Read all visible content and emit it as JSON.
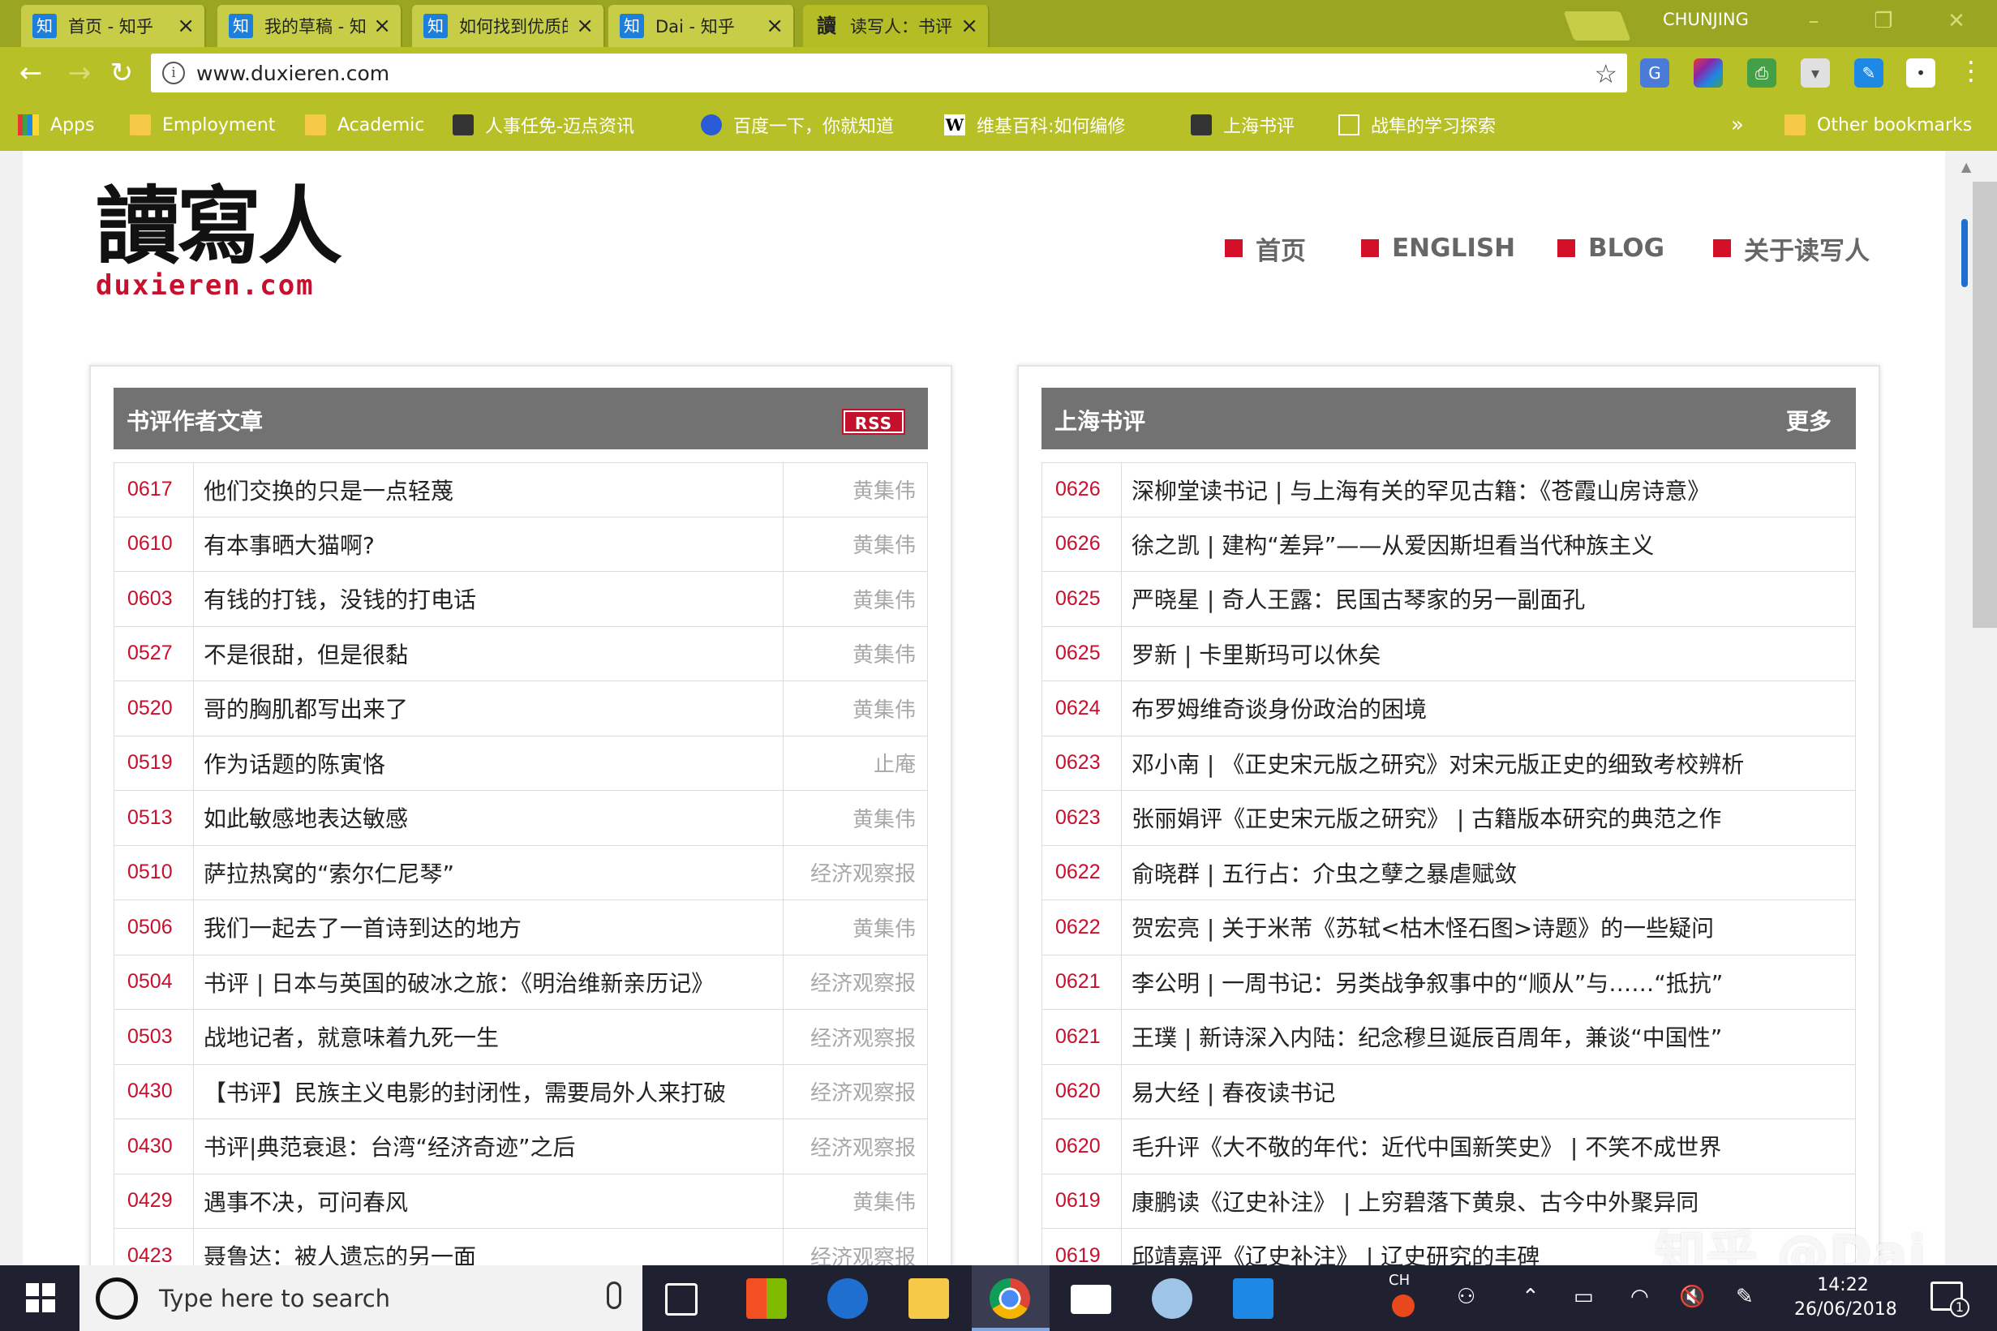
{
  "browser": {
    "tabs": [
      {
        "icon": "知",
        "title": "首页 - 知乎",
        "active": false
      },
      {
        "icon": "知",
        "title": "我的草稿 - 知乎",
        "active": false
      },
      {
        "icon": "知",
        "title": "如何找到优质的书评？有",
        "active": false
      },
      {
        "icon": "知",
        "title": "Dai - 知乎",
        "active": false
      },
      {
        "icon": "讀",
        "title": "读写人：书评杂志、书评",
        "active": true
      }
    ],
    "close_glyph": "×",
    "profile": "CHUNJING",
    "url": "www.duxieren.com",
    "bookmarks": [
      {
        "label": "Apps",
        "icon": "apps-icon"
      },
      {
        "label": "Employment",
        "icon": "folder-icon"
      },
      {
        "label": "Academic",
        "icon": "folder-icon"
      },
      {
        "label": "人事任免-迈点资讯",
        "icon": "mark-icon"
      },
      {
        "label": "百度一下，你就知道",
        "icon": "baidu-icon"
      },
      {
        "label": "维基百科:如何编修",
        "icon": "wiki-icon"
      },
      {
        "label": "上海书评",
        "icon": "mark-icon"
      },
      {
        "label": "战隼的学习探索",
        "icon": "doc-icon"
      }
    ],
    "bookmarks_overflow": "»",
    "other_bookmarks": "Other bookmarks"
  },
  "site": {
    "logo_cn": "讀寫人",
    "logo_en": "duxieren.com",
    "nav": [
      "首页",
      "ENGLISH",
      "BLOG",
      "关于读写人"
    ],
    "accent_color": "#d40f2a"
  },
  "left_panel": {
    "title": "书评作者文章",
    "badge": "RSS",
    "rows": [
      {
        "date": "0617",
        "title": "他们交换的只是一点轻蔑",
        "author": "黄集伟"
      },
      {
        "date": "0610",
        "title": "有本事晒大猫啊?",
        "author": "黄集伟"
      },
      {
        "date": "0603",
        "title": "有钱的打钱，没钱的打电话",
        "author": "黄集伟"
      },
      {
        "date": "0527",
        "title": "不是很甜，但是很黏",
        "author": "黄集伟"
      },
      {
        "date": "0520",
        "title": "哥的胸肌都写出来了",
        "author": "黄集伟"
      },
      {
        "date": "0519",
        "title": "作为话题的陈寅恪",
        "author": "止庵"
      },
      {
        "date": "0513",
        "title": "如此敏感地表达敏感",
        "author": "黄集伟"
      },
      {
        "date": "0510",
        "title": "萨拉热窝的“索尔仁尼琴”",
        "author": "经济观察报"
      },
      {
        "date": "0506",
        "title": "我们一起去了一首诗到达的地方",
        "author": "黄集伟"
      },
      {
        "date": "0504",
        "title": "书评 | 日本与英国的破冰之旅：《明治维新亲历记》",
        "author": "经济观察报"
      },
      {
        "date": "0503",
        "title": "战地记者，就意味着九死一生",
        "author": "经济观察报"
      },
      {
        "date": "0430",
        "title": "【书评】民族主义电影的封闭性，需要局外人来打破",
        "author": "经济观察报"
      },
      {
        "date": "0430",
        "title": "书评|典范衰退：台湾“经济奇迹”之后",
        "author": "经济观察报"
      },
      {
        "date": "0429",
        "title": "遇事不决，可问春风",
        "author": "黄集伟"
      },
      {
        "date": "0423",
        "title": "聂鲁达：被人遗忘的另一面",
        "author": "经济观察报"
      }
    ]
  },
  "right_panel": {
    "title": "上海书评",
    "more": "更多",
    "rows": [
      {
        "date": "0626",
        "title": "深柳堂读书记 | 与上海有关的罕见古籍：《苍霞山房诗意》"
      },
      {
        "date": "0626",
        "title": "徐之凯 | 建构“差异”——从爱因斯坦看当代种族主义"
      },
      {
        "date": "0625",
        "title": "严晓星 | 奇人王露：民国古琴家的另一副面孔"
      },
      {
        "date": "0625",
        "title": "罗新 | 卡里斯玛可以休矣"
      },
      {
        "date": "0624",
        "title": "布罗姆维奇谈身份政治的困境"
      },
      {
        "date": "0623",
        "title": "邓小南 | 《正史宋元版之研究》对宋元版正史的细致考校辨析"
      },
      {
        "date": "0623",
        "title": "张丽娟评《正史宋元版之研究》 | 古籍版本研究的典范之作"
      },
      {
        "date": "0622",
        "title": "俞晓群 | 五行占：介虫之孽之暴虐赋敛"
      },
      {
        "date": "0622",
        "title": "贺宏亮 | 关于米芾《苏轼<枯木怪石图>诗题》的一些疑问"
      },
      {
        "date": "0621",
        "title": "李公明 | 一周书记：另类战争叙事中的“顺从”与……“抵抗”"
      },
      {
        "date": "0621",
        "title": "王璞 | 新诗深入内陆：纪念穆旦诞辰百周年，兼谈“中国性”"
      },
      {
        "date": "0620",
        "title": "易大经 | 春夜读书记"
      },
      {
        "date": "0620",
        "title": "毛升评《大不敬的年代：近代中国新笑史》 | 不笑不成世界"
      },
      {
        "date": "0619",
        "title": "康鹏读《辽史补注》 | 上穷碧落下黄泉、古今中外聚异同"
      },
      {
        "date": "0619",
        "title": "邱靖嘉评《辽史补注》 | 辽史研究的丰碑"
      }
    ]
  },
  "watermark": "知乎 @Dai",
  "taskbar": {
    "search_placeholder": "Type here to search",
    "ime_label": "CH",
    "time": "14:22",
    "date": "26/06/2018",
    "notification_count": "1"
  }
}
